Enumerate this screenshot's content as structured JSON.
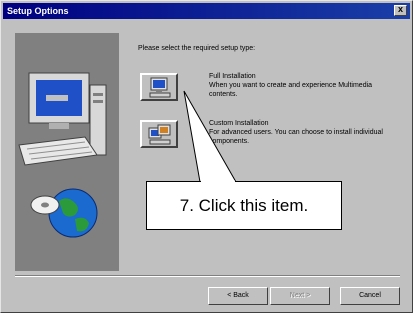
{
  "window": {
    "title": "Setup Options",
    "close_glyph": "x"
  },
  "intro_text": "Please select the required setup type:",
  "options": [
    {
      "title": "Full Installation",
      "description": "When you want to create and experience Multimedia contents.",
      "icon": "full-install-computer-icon"
    },
    {
      "title": "Custom Installation",
      "description": "For advanced users. You can choose to install individual components.",
      "icon": "custom-install-computer-icon"
    }
  ],
  "buttons": {
    "back": "< Back",
    "next": "Next >",
    "cancel": "Cancel"
  },
  "callout": {
    "text": "7. Click this item."
  },
  "colors": {
    "title_bar": "#000080",
    "dialog_face": "#c0c0c0",
    "art_panel": "#808080",
    "monitor_screen": "#2050c8"
  }
}
